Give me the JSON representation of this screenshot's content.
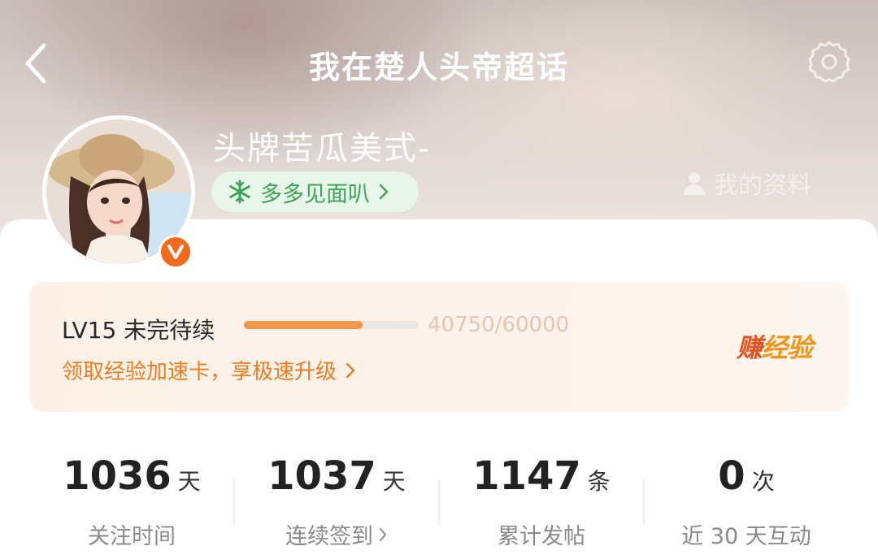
{
  "header": {
    "title": "我在楚人头帝超话"
  },
  "profile": {
    "username": "头牌苦瓜美式-",
    "group_tag": "多多见面叭",
    "profile_link": "我的资料"
  },
  "level": {
    "title": "LV15 未完待续",
    "progress_text": "40750/60000",
    "progress_value": 0.679,
    "boost_text": "领取经验加速卡，享极速升级",
    "earn_part1": "赚",
    "earn_part2": "经验"
  },
  "stats": [
    {
      "value": "1036",
      "unit": "天",
      "label": "关注时间",
      "has_chevron": false
    },
    {
      "value": "1037",
      "unit": "天",
      "label": "连续签到",
      "has_chevron": true
    },
    {
      "value": "1147",
      "unit": "条",
      "label": "累计发帖",
      "has_chevron": false
    },
    {
      "value": "0",
      "unit": "次",
      "label": "近 30 天互动",
      "has_chevron": false
    }
  ],
  "colors": {
    "accent_orange": "#f4944a",
    "tag_green": "#3fa45a",
    "verified_orange": "#f26b1d"
  },
  "icons": {
    "back": "back-arrow-icon",
    "settings": "gear-icon",
    "tag": "snowflake-icon",
    "profile": "person-icon",
    "verified": "verified-v-icon"
  }
}
